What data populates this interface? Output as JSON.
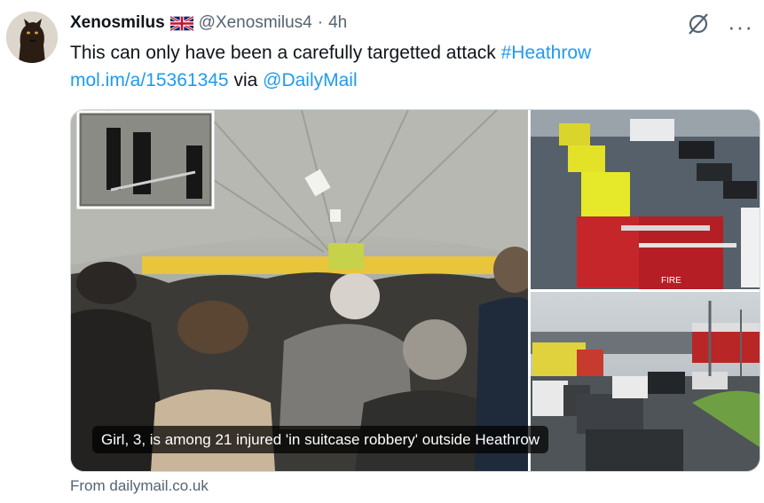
{
  "author": {
    "name": "Xenosmilus",
    "flag_icon": "uk-flag-icon",
    "handle": "@Xenosmilus4",
    "separator": "·",
    "time": "4h"
  },
  "tweet": {
    "text_plain": "This can only have been a carefully targetted attack ",
    "hashtag": "#Heathrow",
    "link": "mol.im/a/15361345",
    "via": " via ",
    "mention": "@DailyMail"
  },
  "card": {
    "caption": "Girl, 3, is among 21 injured 'in suitcase robbery' outside Heathrow",
    "source": "From dailymail.co.uk",
    "fire_text": "FIRE"
  },
  "icons": {
    "avatar": "panther-avatar",
    "grok": "grok-icon",
    "more": "more-icon"
  },
  "colors": {
    "link": "#1d9bf0",
    "muted": "#536471",
    "text": "#0f1419"
  }
}
